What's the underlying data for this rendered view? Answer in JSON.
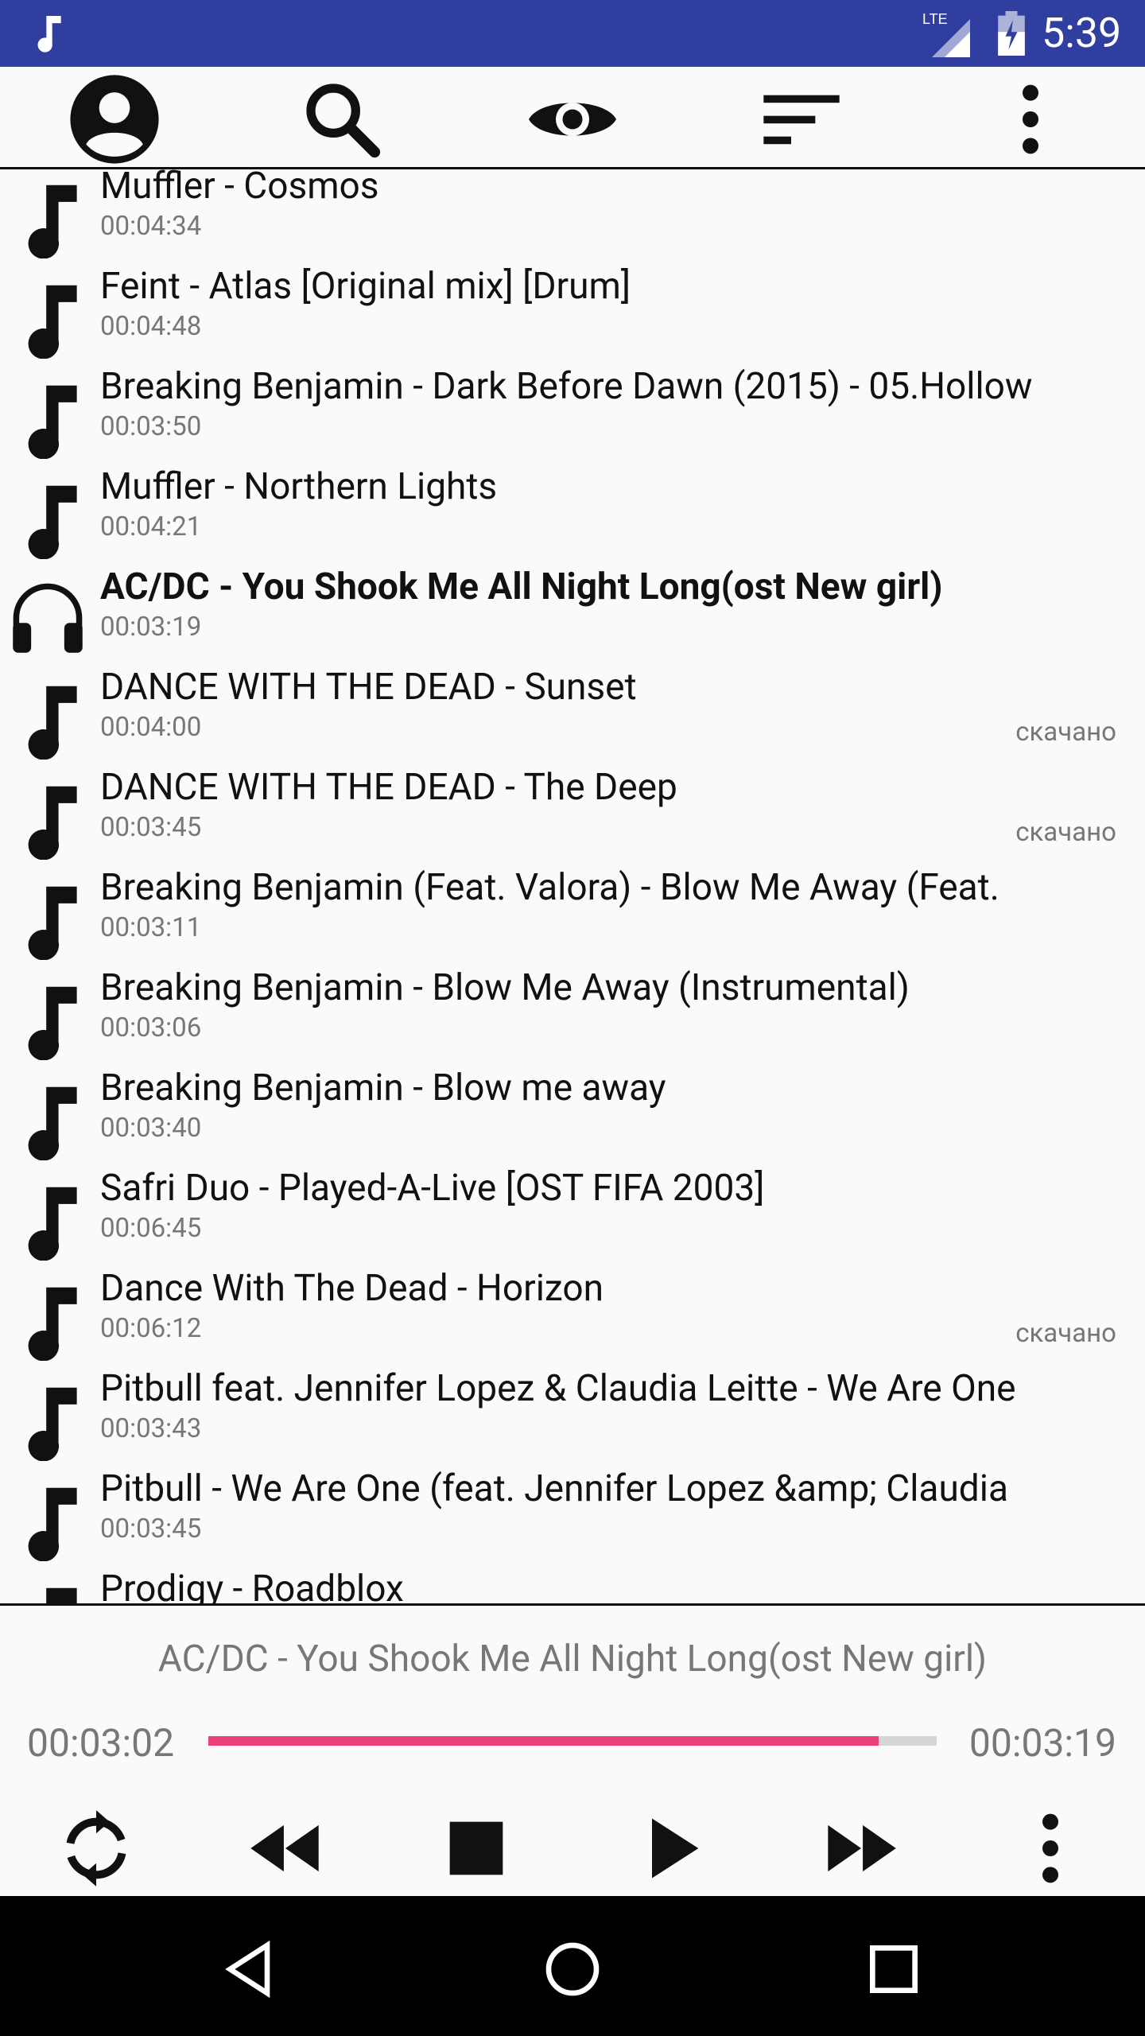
{
  "status_bar": {
    "time": "5:39",
    "network_label": "LTE",
    "app_icon": "music-note-icon",
    "background": "#303f9f"
  },
  "toolbar": {
    "icons": [
      "account-icon",
      "search-icon",
      "eye-icon",
      "sort-icon",
      "more-vert-icon"
    ]
  },
  "songs": [
    {
      "title": "Muffler - Cosmos",
      "duration": "00:04:34",
      "badge": "",
      "icon": "music-note-icon",
      "playing": false
    },
    {
      "title": "Feint - Atlas [Original mix] [Drum]",
      "duration": "00:04:48",
      "badge": "",
      "icon": "music-note-icon",
      "playing": false
    },
    {
      "title": "Breaking Benjamin - Dark Before Dawn (2015) - 05.Hollow",
      "duration": "00:03:50",
      "badge": "",
      "icon": "music-note-icon",
      "playing": false
    },
    {
      "title": "Muffler - Northern Lights",
      "duration": "00:04:21",
      "badge": "",
      "icon": "music-note-icon",
      "playing": false
    },
    {
      "title": "AC/DC - You Shook Me All Night Long(ost New girl)",
      "duration": "00:03:19",
      "badge": "",
      "icon": "headphones-icon",
      "playing": true
    },
    {
      "title": "DANCE WITH THE DEAD - Sunset",
      "duration": "00:04:00",
      "badge": "скачано",
      "icon": "music-note-icon",
      "playing": false
    },
    {
      "title": "DANCE WITH THE DEAD - The Deep",
      "duration": "00:03:45",
      "badge": "скачано",
      "icon": "music-note-icon",
      "playing": false
    },
    {
      "title": "Breaking Benjamin (Feat. Valora) - Blow Me Away (Feat.",
      "duration": "00:03:11",
      "badge": "",
      "icon": "music-note-icon",
      "playing": false
    },
    {
      "title": "Breaking Benjamin - Blow Me Away (Instrumental)",
      "duration": "00:03:06",
      "badge": "",
      "icon": "music-note-icon",
      "playing": false
    },
    {
      "title": "Breaking Benjamin - Blow me away",
      "duration": "00:03:40",
      "badge": "",
      "icon": "music-note-icon",
      "playing": false
    },
    {
      "title": "Safri Duo - Played-A-Live [OST FIFA 2003]",
      "duration": "00:06:45",
      "badge": "",
      "icon": "music-note-icon",
      "playing": false
    },
    {
      "title": "Dance With The Dead - Horizon",
      "duration": "00:06:12",
      "badge": "скачано",
      "icon": "music-note-icon",
      "playing": false
    },
    {
      "title": "Pitbull feat. Jennifer Lopez & Claudia Leitte - We Are One",
      "duration": "00:03:43",
      "badge": "",
      "icon": "music-note-icon",
      "playing": false
    },
    {
      "title": "Pitbull - We Are One (feat. Jennifer Lopez &amp; Claudia",
      "duration": "00:03:45",
      "badge": "",
      "icon": "music-note-icon",
      "playing": false
    },
    {
      "title": "Prodigy - Roadblox",
      "duration": "",
      "badge": "",
      "icon": "music-note-icon",
      "playing": false
    }
  ],
  "player": {
    "now_playing": "AC/DC - You Shook Me All Night Long(ost New girl)",
    "current_time": "00:03:02",
    "total_time": "00:03:19",
    "progress_fraction": 0.92,
    "accent_color": "#ec407a",
    "controls": [
      "repeat-icon",
      "rewind-icon",
      "stop-icon",
      "play-icon",
      "fast-forward-icon",
      "more-vert-icon"
    ]
  },
  "nav_bar": {
    "buttons": [
      "back-icon",
      "home-icon",
      "recents-icon"
    ]
  }
}
